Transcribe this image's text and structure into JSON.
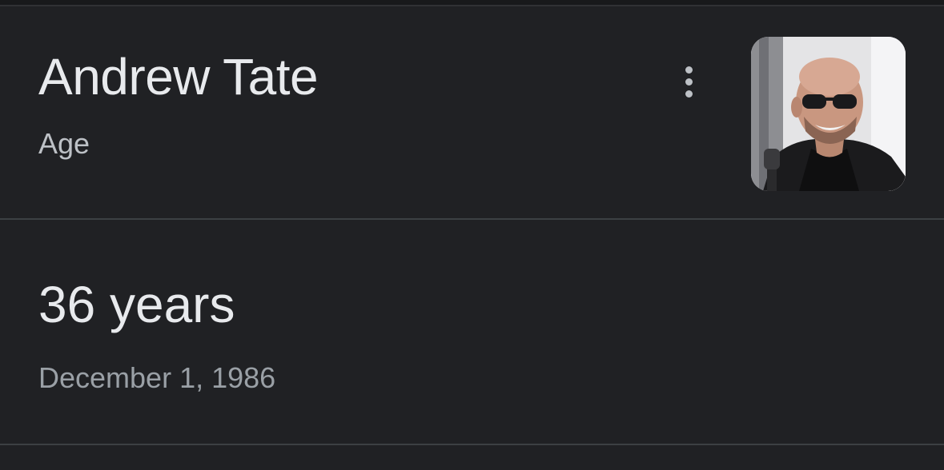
{
  "knowledge_panel": {
    "title": "Andrew Tate",
    "subtitle": "Age",
    "more_options_icon": "more-vert-icon",
    "thumbnail_subject": "person-photo"
  },
  "answer": {
    "value": "36 years",
    "detail": "December 1, 1986"
  },
  "colors": {
    "background": "#202124",
    "primary_text": "#e8eaed",
    "secondary_text": "#9aa0a6",
    "divider": "#3c4043"
  }
}
